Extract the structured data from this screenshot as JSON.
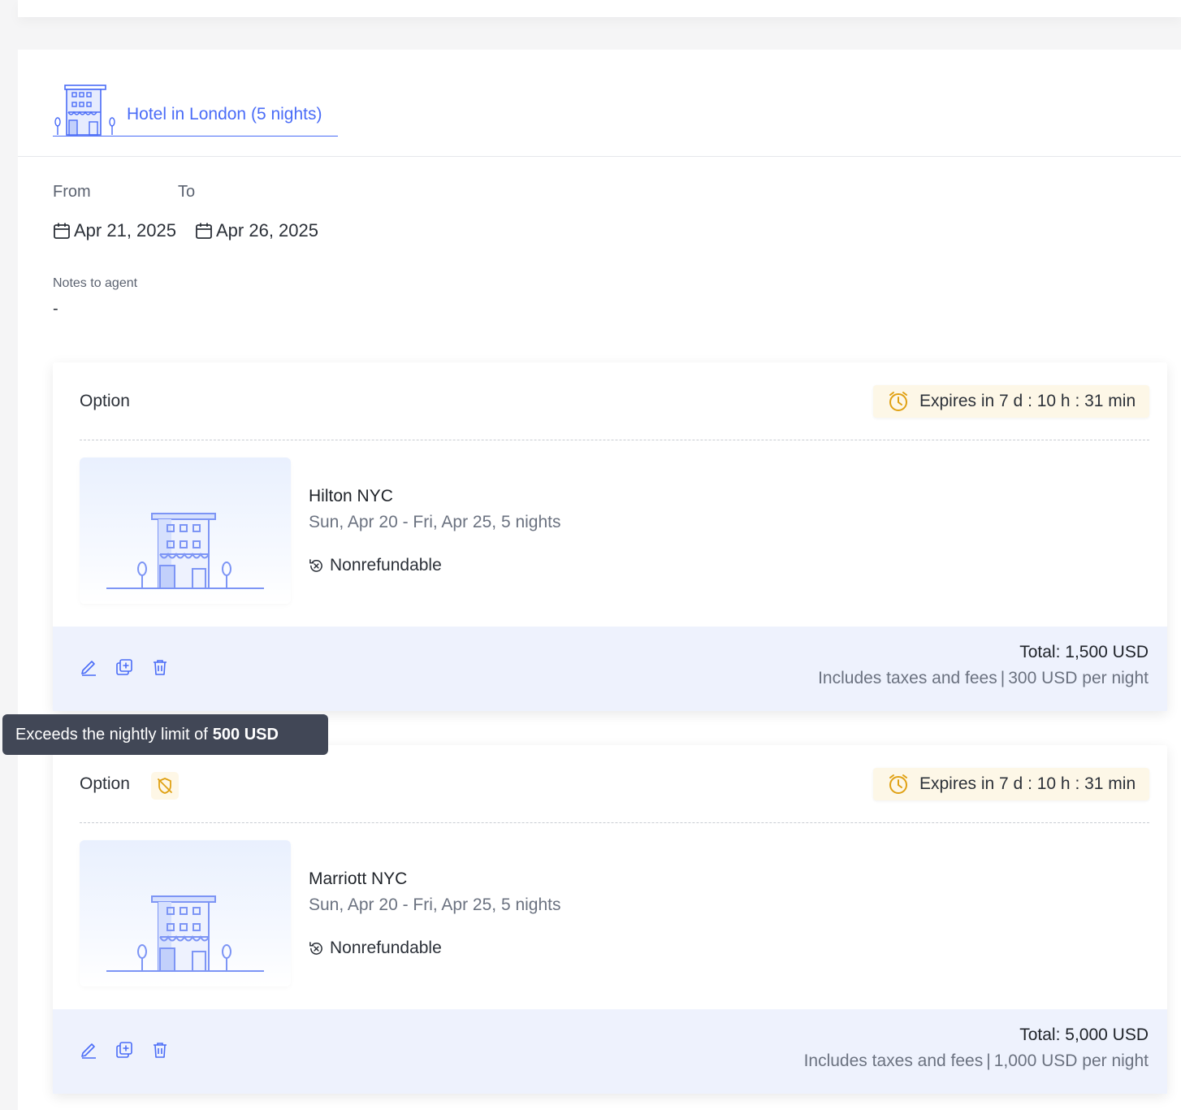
{
  "header": {
    "title": "Hotel in London (5 nights)"
  },
  "dates": {
    "from_label": "From",
    "to_label": "To",
    "from_value": "Apr 21, 2025",
    "to_value": "Apr 26, 2025"
  },
  "notes": {
    "label": "Notes to agent",
    "value": "-"
  },
  "tooltip": {
    "text": "Exceeds the nightly limit of",
    "amount": "500 USD"
  },
  "options": [
    {
      "label": "Option",
      "expiry": "Expires in 7 d : 10 h : 31 min",
      "hotel_name": "Hilton NYC",
      "hotel_dates": "Sun, Apr 20 - Fri, Apr 25, 5 nights",
      "refund": "Nonrefundable",
      "total": "Total: 1,500 USD",
      "includes": "Includes taxes and fees",
      "per_night": "300 USD per night",
      "out_of_policy": false
    },
    {
      "label": "Option",
      "expiry": "Expires in 7 d : 10 h : 31 min",
      "hotel_name": "Marriott NYC",
      "hotel_dates": "Sun, Apr 20 - Fri, Apr 25, 5 nights",
      "refund": "Nonrefundable",
      "total": "Total: 5,000 USD",
      "includes": "Includes taxes and fees",
      "per_night": "1,000 USD per night",
      "out_of_policy": true
    }
  ],
  "colors": {
    "accent": "#4a6cf7",
    "warning": "#e0a114",
    "footer_bg": "#eef2fd",
    "tooltip_bg": "#414756"
  },
  "icons": {
    "header": "hotel-building-icon",
    "date": "calendar-icon",
    "expiry": "alarm-clock-icon",
    "refund": "no-refund-icon",
    "edit": "pencil-icon",
    "duplicate": "duplicate-icon",
    "delete": "trash-icon",
    "policy": "shield-off-icon"
  }
}
